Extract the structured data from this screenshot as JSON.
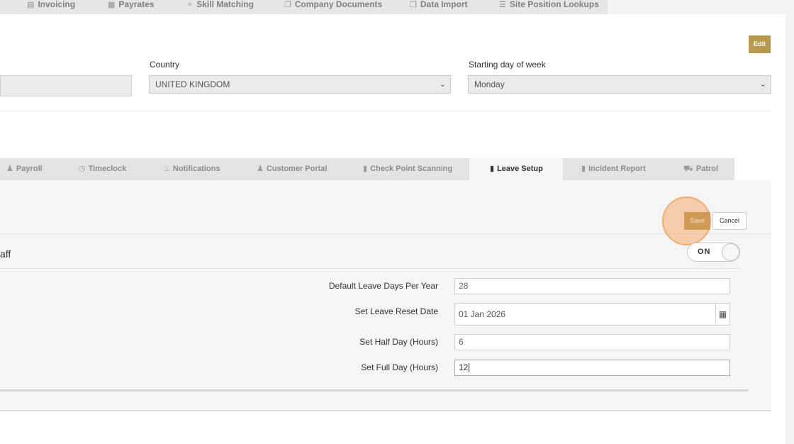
{
  "topnav": {
    "items": [
      {
        "label": "Invoicing",
        "icon": "invoice-icon"
      },
      {
        "label": "Payrates",
        "icon": "calendar-icon"
      },
      {
        "label": "Skill Matching",
        "icon": "crosshair-icon"
      },
      {
        "label": "Company Documents",
        "icon": "documents-icon"
      },
      {
        "label": "Data Import",
        "icon": "import-icon"
      },
      {
        "label": "Site Position Lookups",
        "icon": "list-icon"
      }
    ]
  },
  "header": {
    "edit_label": "Edit",
    "country_label": "Country",
    "country_value": "UNITED KINGDOM",
    "week_label": "Starting day of week",
    "week_value": "Monday"
  },
  "tabs": [
    {
      "label": "Payroll",
      "icon": "user-icon"
    },
    {
      "label": "Timeclock",
      "icon": "clock-icon"
    },
    {
      "label": "Notifications",
      "icon": "bell-icon"
    },
    {
      "label": "Customer Portal",
      "icon": "user-icon"
    },
    {
      "label": "Check Point Scanning",
      "icon": "file-icon"
    },
    {
      "label": "Leave Setup",
      "icon": "file-icon"
    },
    {
      "label": "Incident Report",
      "icon": "file-icon"
    },
    {
      "label": "Patrol",
      "icon": "car-icon"
    }
  ],
  "active_tab": "Leave Setup",
  "leave": {
    "save_label": "Save",
    "cancel_label": "Cancel",
    "staff_label": "aff",
    "toggle_label": "ON",
    "fields": [
      {
        "label": "Default Leave Days Per Year",
        "value": "28"
      },
      {
        "label": "Set Leave Reset Date",
        "value": "01 Jan 2026"
      },
      {
        "label": "Set Half Day (Hours)",
        "value": "6"
      },
      {
        "label": "Set Full Day (Hours)",
        "value": "12"
      }
    ]
  },
  "colors": {
    "accent": "#b89a4c",
    "save": "#cf9a55",
    "highlight": "#f5aa6e"
  }
}
